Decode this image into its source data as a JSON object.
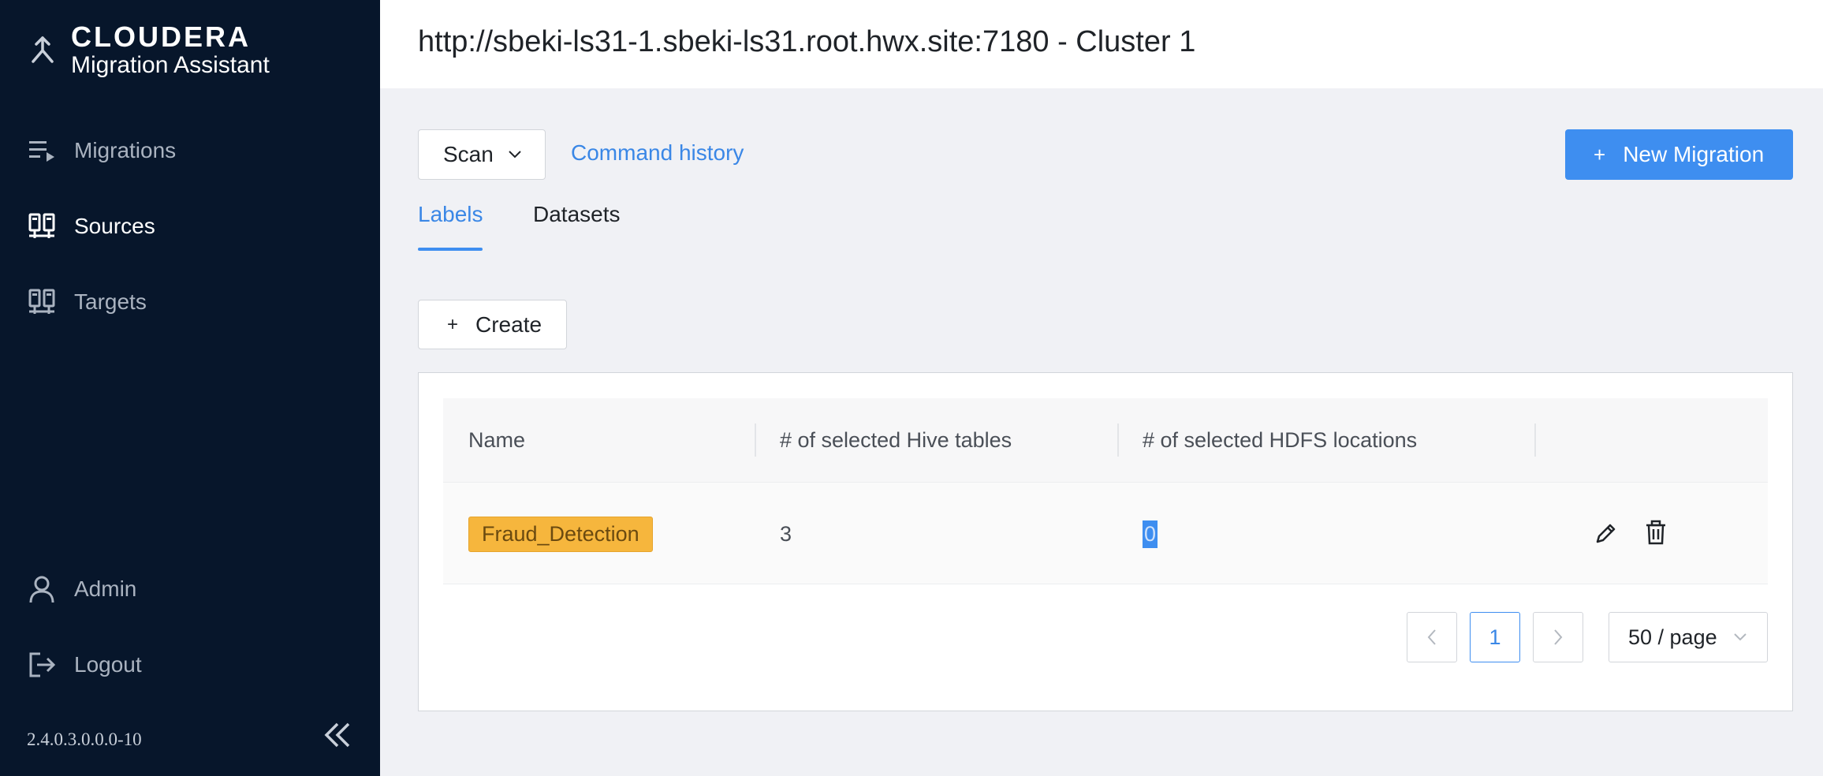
{
  "brand": {
    "name": "CLOUDERA",
    "subtitle": "Migration Assistant"
  },
  "sidebar": {
    "items": [
      {
        "label": "Migrations",
        "icon": "migrations-list-icon",
        "active": false
      },
      {
        "label": "Sources",
        "icon": "sources-icon",
        "active": true
      },
      {
        "label": "Targets",
        "icon": "targets-icon",
        "active": false
      }
    ],
    "bottom_items": [
      {
        "label": "Admin",
        "icon": "user-icon"
      },
      {
        "label": "Logout",
        "icon": "logout-icon"
      }
    ],
    "version": "2.4.0.3.0.0.0-10"
  },
  "header": {
    "title": "http://sbeki-ls31-1.sbeki-ls31.root.hwx.site:7180 - Cluster 1"
  },
  "toolbar": {
    "scan_label": "Scan",
    "command_history_label": "Command history",
    "new_migration_label": "New Migration"
  },
  "tabs": [
    {
      "label": "Labels",
      "active": true
    },
    {
      "label": "Datasets",
      "active": false
    }
  ],
  "create_label": "Create",
  "table": {
    "columns": [
      "Name",
      "# of selected Hive tables",
      "# of selected HDFS locations",
      ""
    ],
    "rows": [
      {
        "name": "Fraud_Detection",
        "hive_tables": "3",
        "hdfs_locations": "0"
      }
    ]
  },
  "pagination": {
    "current_page": "1",
    "page_size": "50 / page"
  },
  "colors": {
    "sidebar_bg": "#07162b",
    "accent": "#3e8ef0",
    "tag": "#f6b63d"
  }
}
